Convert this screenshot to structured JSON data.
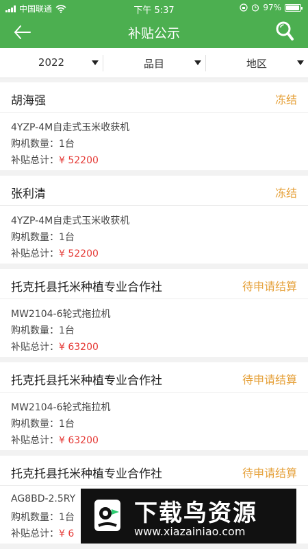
{
  "status_bar": {
    "carrier": "中国联通",
    "time": "下午 5:37",
    "battery": "97%",
    "battery_level": 0.97
  },
  "navbar": {
    "title": "补贴公示",
    "back_icon": "arrow-left-icon",
    "search_icon": "search-icon"
  },
  "filters": [
    {
      "label": "2022"
    },
    {
      "label": "品目"
    },
    {
      "label": "地区"
    }
  ],
  "labels": {
    "qty_prefix": "购机数量：",
    "total_prefix": "补贴总计："
  },
  "records": [
    {
      "name": "胡海强",
      "status": "冻结",
      "machine": "4YZP-4M自走式玉米收获机",
      "qty": "1台",
      "amount": "¥ 52200"
    },
    {
      "name": "张利清",
      "status": "冻结",
      "machine": "4YZP-4M自走式玉米收获机",
      "qty": "1台",
      "amount": "¥ 52200"
    },
    {
      "name": "托克托县托米种植专业合作社",
      "status": "待申请结算",
      "machine": "MW2104-6轮式拖拉机",
      "qty": "1台",
      "amount": "¥ 63200"
    },
    {
      "name": "托克托县托米种植专业合作社",
      "status": "待申请结算",
      "machine": "MW2104-6轮式拖拉机",
      "qty": "1台",
      "amount": "¥ 63200"
    },
    {
      "name": "托克托县托米种植专业合作社",
      "status": "待申请结算",
      "machine": "AG8BD-2.5RY",
      "qty": "1台",
      "amount": "¥ 6"
    }
  ],
  "watermark": {
    "title": "下载鸟资源",
    "url": "www.xiazainiao.com"
  },
  "colors": {
    "primary": "#4caf50",
    "status": "#e6a23c",
    "amount": "#e53935"
  }
}
